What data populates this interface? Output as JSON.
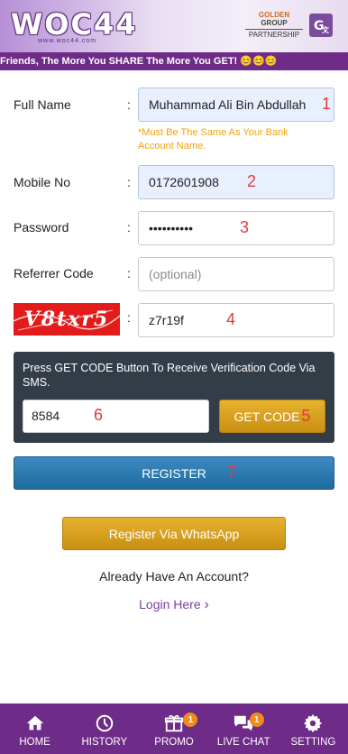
{
  "header": {
    "logo_text": "WOC44",
    "logo_sub": "www.woc44.com",
    "partner_brand_a": "GOLDEN",
    "partner_brand_b": "GROUP",
    "partner_label": "PARTNERSHIP",
    "translate_icon": "translate-icon"
  },
  "marquee": {
    "text": "Friends, The More You SHARE The More You GET!",
    "emojis": "😊😊😊"
  },
  "form": {
    "full_name": {
      "label": "Full Name",
      "value": "Muhammad Ali Bin Abdullah",
      "marker": "1"
    },
    "hint": "*Must Be The Same As Your Bank Account Name.",
    "mobile": {
      "label": "Mobile No",
      "value": "0172601908",
      "marker": "2"
    },
    "password": {
      "label": "Password",
      "value": "••••••••••",
      "marker": "3"
    },
    "referrer": {
      "label": "Referrer Code",
      "placeholder": "(optional)"
    },
    "captcha": {
      "image_text": "V8txr5",
      "value": "z7r19f",
      "marker": "4"
    },
    "colon": ":"
  },
  "sms": {
    "instruction": "Press GET CODE Button To Receive Verification Code Via SMS.",
    "code_value": "8584",
    "code_marker": "6",
    "get_code_label": "GET CODE",
    "get_code_marker": "5"
  },
  "register": {
    "label": "REGISTER",
    "marker": "7"
  },
  "whatsapp_label": "Register Via WhatsApp",
  "have_account": "Already Have An Account?",
  "login_link": "Login Here",
  "login_chevron": "›",
  "nav": [
    {
      "label": "HOME",
      "icon": "home-icon"
    },
    {
      "label": "HISTORY",
      "icon": "clock-icon"
    },
    {
      "label": "PROMO",
      "icon": "gift-icon",
      "badge": "1"
    },
    {
      "label": "LIVE CHAT",
      "icon": "chat-icon",
      "badge": "1"
    },
    {
      "label": "SETTING",
      "icon": "gear-icon"
    }
  ],
  "colors": {
    "purple": "#6e2b87",
    "gold": "#d9a21f",
    "blue": "#2a7bb2",
    "dark_panel": "#333d48",
    "marker_red": "#e23b3b",
    "hint_orange": "#f2a20a",
    "badge_orange": "#ef8c1b"
  }
}
